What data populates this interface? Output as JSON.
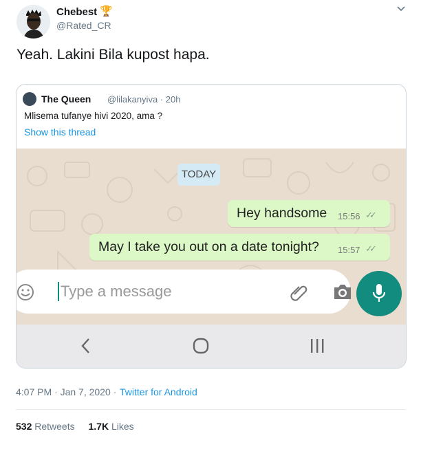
{
  "author": {
    "name": "Chebest",
    "handle": "@Rated_CR",
    "badge_icon": "trophy-icon"
  },
  "tweet": {
    "text": "Yeah. Lakini Bila kupost hapa."
  },
  "quoted_tweet": {
    "name": "The Queen",
    "handle": "@lilakanyiva",
    "time": "20h",
    "text": "Mlisema tufanye hivi 2020, ama ?",
    "show_thread": "Show this thread",
    "chat": {
      "date_badge": "TODAY",
      "messages": [
        {
          "text": "Hey handsome",
          "time": "15:56"
        },
        {
          "text": "May I take you out on a date tonight?",
          "time": "15:57"
        }
      ],
      "input_placeholder": "Type a message",
      "colors": {
        "bubble": "#dcf8c6",
        "mic": "#128c7e",
        "wallpaper": "#e9ddd0"
      }
    }
  },
  "footer": {
    "timestamp": "4:07 PM · Jan 7, 2020 ·",
    "source": "Twitter for Android",
    "retweets_count": "532",
    "retweets_label": "Retweets",
    "likes_count": "1.7K",
    "likes_label": "Likes"
  }
}
